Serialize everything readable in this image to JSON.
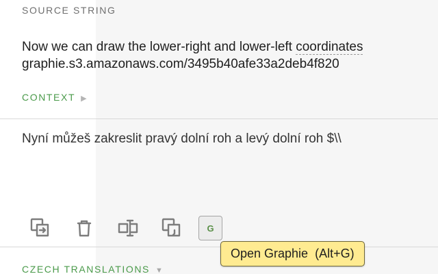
{
  "source": {
    "label": "SOURCE STRING",
    "line1_prefix": "Now we can draw the lower-right and lower-left ",
    "line1_dashed": "coordinates",
    "line2": "graphie.s3.amazonaws.com/3495b40afe33a2deb4f820"
  },
  "context": {
    "label": "CONTEXT",
    "caret": "▶"
  },
  "translation": {
    "text": "Nyní můžeš zakreslit pravý dolní roh a levý dolní roh $\\\\"
  },
  "toolbar": {
    "copy_icon": "copy-source-icon",
    "delete_icon": "trash-icon",
    "cursor_icon": "text-cursor-icon",
    "paste_icon": "paste-icon",
    "graphie_label": "G"
  },
  "tooltip": {
    "text": "Open Graphie  (Alt+G)"
  },
  "czech": {
    "label": "CZECH TRANSLATIONS",
    "caret": "▼"
  }
}
